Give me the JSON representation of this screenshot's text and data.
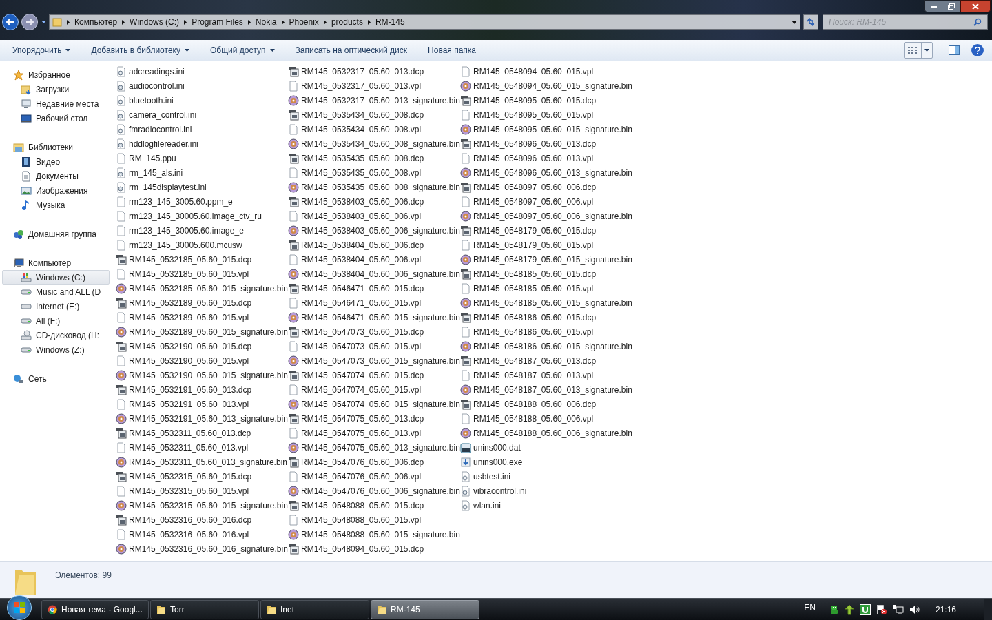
{
  "address_bar": {
    "crumbs": [
      "Компьютер",
      "Windows (C:)",
      "Program Files",
      "Nokia",
      "Phoenix",
      "products",
      "RM-145"
    ]
  },
  "search": {
    "placeholder": "Поиск: RM-145"
  },
  "toolbar": {
    "items": [
      {
        "label": "Упорядочить",
        "dropdown": true
      },
      {
        "label": "Добавить в библиотеку",
        "dropdown": true
      },
      {
        "label": "Общий доступ",
        "dropdown": true
      },
      {
        "label": "Записать на оптический диск",
        "dropdown": false
      },
      {
        "label": "Новая папка",
        "dropdown": false
      }
    ]
  },
  "sidebar": {
    "groups": [
      {
        "label": "Избранное",
        "kind": "star",
        "items": [
          {
            "label": "Загрузки",
            "kind": "downloads",
            "selected": false
          },
          {
            "label": "Недавние места",
            "kind": "recent",
            "selected": false
          },
          {
            "label": "Рабочий стол",
            "kind": "desktop",
            "selected": false
          }
        ]
      },
      {
        "label": "Библиотеки",
        "kind": "library",
        "items": [
          {
            "label": "Видео",
            "kind": "video",
            "selected": false
          },
          {
            "label": "Документы",
            "kind": "docs",
            "selected": false
          },
          {
            "label": "Изображения",
            "kind": "pictures",
            "selected": false
          },
          {
            "label": "Музыка",
            "kind": "music",
            "selected": false
          }
        ]
      },
      {
        "label": "Домашняя группа",
        "kind": "homegroup"
      },
      {
        "label": "Компьютер",
        "kind": "computer",
        "items": [
          {
            "label": "Windows (C:)",
            "kind": "sysdrive",
            "selected": true
          },
          {
            "label": "Music and ALL (D",
            "kind": "drive",
            "selected": false
          },
          {
            "label": "Internet (E:)",
            "kind": "drive",
            "selected": false
          },
          {
            "label": "All (F:)",
            "kind": "drive",
            "selected": false
          },
          {
            "label": "CD-дисковод (H:",
            "kind": "cd",
            "selected": false
          },
          {
            "label": "Windows (Z:)",
            "kind": "drive",
            "selected": false
          }
        ]
      },
      {
        "label": "Сеть",
        "kind": "network"
      }
    ]
  },
  "files": [
    {
      "name": "adcreadings.ini",
      "kind": "ini"
    },
    {
      "name": "audiocontrol.ini",
      "kind": "ini"
    },
    {
      "name": "bluetooth.ini",
      "kind": "ini"
    },
    {
      "name": "camera_control.ini",
      "kind": "ini"
    },
    {
      "name": "fmradiocontrol.ini",
      "kind": "ini"
    },
    {
      "name": "hddlogfilereader.ini",
      "kind": "ini"
    },
    {
      "name": "RM_145.ppu",
      "kind": "file"
    },
    {
      "name": "rm_145_als.ini",
      "kind": "ini"
    },
    {
      "name": "rm_145displaytest.ini",
      "kind": "ini"
    },
    {
      "name": "rm123_145_3005.60.ppm_e",
      "kind": "file"
    },
    {
      "name": "rm123_145_30005.60.image_ctv_ru",
      "kind": "file"
    },
    {
      "name": "rm123_145_30005.60.image_e",
      "kind": "file"
    },
    {
      "name": "rm123_145_30005.600.mcusw",
      "kind": "file"
    },
    {
      "name": "RM145_0532185_05.60_015.dcp",
      "kind": "dcp"
    },
    {
      "name": "RM145_0532185_05.60_015.vpl",
      "kind": "file"
    },
    {
      "name": "RM145_0532185_05.60_015_signature.bin",
      "kind": "bin"
    },
    {
      "name": "RM145_0532189_05.60_015.dcp",
      "kind": "dcp"
    },
    {
      "name": "RM145_0532189_05.60_015.vpl",
      "kind": "file"
    },
    {
      "name": "RM145_0532189_05.60_015_signature.bin",
      "kind": "bin"
    },
    {
      "name": "RM145_0532190_05.60_015.dcp",
      "kind": "dcp"
    },
    {
      "name": "RM145_0532190_05.60_015.vpl",
      "kind": "file"
    },
    {
      "name": "RM145_0532190_05.60_015_signature.bin",
      "kind": "bin"
    },
    {
      "name": "RM145_0532191_05.60_013.dcp",
      "kind": "dcp"
    },
    {
      "name": "RM145_0532191_05.60_013.vpl",
      "kind": "file"
    },
    {
      "name": "RM145_0532191_05.60_013_signature.bin",
      "kind": "bin"
    },
    {
      "name": "RM145_0532311_05.60_013.dcp",
      "kind": "dcp"
    },
    {
      "name": "RM145_0532311_05.60_013.vpl",
      "kind": "file"
    },
    {
      "name": "RM145_0532311_05.60_013_signature.bin",
      "kind": "bin"
    },
    {
      "name": "RM145_0532315_05.60_015.dcp",
      "kind": "dcp"
    },
    {
      "name": "RM145_0532315_05.60_015.vpl",
      "kind": "file"
    },
    {
      "name": "RM145_0532315_05.60_015_signature.bin",
      "kind": "bin"
    },
    {
      "name": "RM145_0532316_05.60_016.dcp",
      "kind": "dcp"
    },
    {
      "name": "RM145_0532316_05.60_016.vpl",
      "kind": "file"
    },
    {
      "name": "RM145_0532316_05.60_016_signature.bin",
      "kind": "bin"
    },
    {
      "name": "RM145_0532317_05.60_013.dcp",
      "kind": "dcp"
    },
    {
      "name": "RM145_0532317_05.60_013.vpl",
      "kind": "file"
    },
    {
      "name": "RM145_0532317_05.60_013_signature.bin",
      "kind": "bin"
    },
    {
      "name": "RM145_0535434_05.60_008.dcp",
      "kind": "dcp"
    },
    {
      "name": "RM145_0535434_05.60_008.vpl",
      "kind": "file"
    },
    {
      "name": "RM145_0535434_05.60_008_signature.bin",
      "kind": "bin"
    },
    {
      "name": "RM145_0535435_05.60_008.dcp",
      "kind": "dcp"
    },
    {
      "name": "RM145_0535435_05.60_008.vpl",
      "kind": "file"
    },
    {
      "name": "RM145_0535435_05.60_008_signature.bin",
      "kind": "bin"
    },
    {
      "name": "RM145_0538403_05.60_006.dcp",
      "kind": "dcp"
    },
    {
      "name": "RM145_0538403_05.60_006.vpl",
      "kind": "file"
    },
    {
      "name": "RM145_0538403_05.60_006_signature.bin",
      "kind": "bin"
    },
    {
      "name": "RM145_0538404_05.60_006.dcp",
      "kind": "dcp"
    },
    {
      "name": "RM145_0538404_05.60_006.vpl",
      "kind": "file"
    },
    {
      "name": "RM145_0538404_05.60_006_signature.bin",
      "kind": "bin"
    },
    {
      "name": "RM145_0546471_05.60_015.dcp",
      "kind": "dcp"
    },
    {
      "name": "RM145_0546471_05.60_015.vpl",
      "kind": "file"
    },
    {
      "name": "RM145_0546471_05.60_015_signature.bin",
      "kind": "bin"
    },
    {
      "name": "RM145_0547073_05.60_015.dcp",
      "kind": "dcp"
    },
    {
      "name": "RM145_0547073_05.60_015.vpl",
      "kind": "file"
    },
    {
      "name": "RM145_0547073_05.60_015_signature.bin",
      "kind": "bin"
    },
    {
      "name": "RM145_0547074_05.60_015.dcp",
      "kind": "dcp"
    },
    {
      "name": "RM145_0547074_05.60_015.vpl",
      "kind": "file"
    },
    {
      "name": "RM145_0547074_05.60_015_signature.bin",
      "kind": "bin"
    },
    {
      "name": "RM145_0547075_05.60_013.dcp",
      "kind": "dcp"
    },
    {
      "name": "RM145_0547075_05.60_013.vpl",
      "kind": "file"
    },
    {
      "name": "RM145_0547075_05.60_013_signature.bin",
      "kind": "bin"
    },
    {
      "name": "RM145_0547076_05.60_006.dcp",
      "kind": "dcp"
    },
    {
      "name": "RM145_0547076_05.60_006.vpl",
      "kind": "file"
    },
    {
      "name": "RM145_0547076_05.60_006_signature.bin",
      "kind": "bin"
    },
    {
      "name": "RM145_0548088_05.60_015.dcp",
      "kind": "dcp"
    },
    {
      "name": "RM145_0548088_05.60_015.vpl",
      "kind": "file"
    },
    {
      "name": "RM145_0548088_05.60_015_signature.bin",
      "kind": "bin"
    },
    {
      "name": "RM145_0548094_05.60_015.dcp",
      "kind": "dcp"
    },
    {
      "name": "RM145_0548094_05.60_015.vpl",
      "kind": "file"
    },
    {
      "name": "RM145_0548094_05.60_015_signature.bin",
      "kind": "bin"
    },
    {
      "name": "RM145_0548095_05.60_015.dcp",
      "kind": "dcp"
    },
    {
      "name": "RM145_0548095_05.60_015.vpl",
      "kind": "file"
    },
    {
      "name": "RM145_0548095_05.60_015_signature.bin",
      "kind": "bin"
    },
    {
      "name": "RM145_0548096_05.60_013.dcp",
      "kind": "dcp"
    },
    {
      "name": "RM145_0548096_05.60_013.vpl",
      "kind": "file"
    },
    {
      "name": "RM145_0548096_05.60_013_signature.bin",
      "kind": "bin"
    },
    {
      "name": "RM145_0548097_05.60_006.dcp",
      "kind": "dcp"
    },
    {
      "name": "RM145_0548097_05.60_006.vpl",
      "kind": "file"
    },
    {
      "name": "RM145_0548097_05.60_006_signature.bin",
      "kind": "bin"
    },
    {
      "name": "RM145_0548179_05.60_015.dcp",
      "kind": "dcp"
    },
    {
      "name": "RM145_0548179_05.60_015.vpl",
      "kind": "file"
    },
    {
      "name": "RM145_0548179_05.60_015_signature.bin",
      "kind": "bin"
    },
    {
      "name": "RM145_0548185_05.60_015.dcp",
      "kind": "dcp"
    },
    {
      "name": "RM145_0548185_05.60_015.vpl",
      "kind": "file"
    },
    {
      "name": "RM145_0548185_05.60_015_signature.bin",
      "kind": "bin"
    },
    {
      "name": "RM145_0548186_05.60_015.dcp",
      "kind": "dcp"
    },
    {
      "name": "RM145_0548186_05.60_015.vpl",
      "kind": "file"
    },
    {
      "name": "RM145_0548186_05.60_015_signature.bin",
      "kind": "bin"
    },
    {
      "name": "RM145_0548187_05.60_013.dcp",
      "kind": "dcp"
    },
    {
      "name": "RM145_0548187_05.60_013.vpl",
      "kind": "file"
    },
    {
      "name": "RM145_0548187_05.60_013_signature.bin",
      "kind": "bin"
    },
    {
      "name": "RM145_0548188_05.60_006.dcp",
      "kind": "dcp"
    },
    {
      "name": "RM145_0548188_05.60_006.vpl",
      "kind": "file"
    },
    {
      "name": "RM145_0548188_05.60_006_signature.bin",
      "kind": "bin"
    },
    {
      "name": "unins000.dat",
      "kind": "dat"
    },
    {
      "name": "unins000.exe",
      "kind": "exe"
    },
    {
      "name": "usbtest.ini",
      "kind": "ini"
    },
    {
      "name": "vibracontrol.ini",
      "kind": "ini"
    },
    {
      "name": "wlan.ini",
      "kind": "ini"
    }
  ],
  "status_bar": {
    "text": "Элементов: 99"
  },
  "taskbar": {
    "buttons": [
      {
        "label": "Новая тема - Googl...",
        "kind": "browser",
        "selected": false
      },
      {
        "label": "Torr",
        "kind": "folder",
        "selected": false
      },
      {
        "label": "Inet",
        "kind": "folder",
        "selected": false
      },
      {
        "label": "RM-145",
        "kind": "folder",
        "selected": true
      }
    ],
    "language": "EN",
    "clock": "21:16"
  }
}
